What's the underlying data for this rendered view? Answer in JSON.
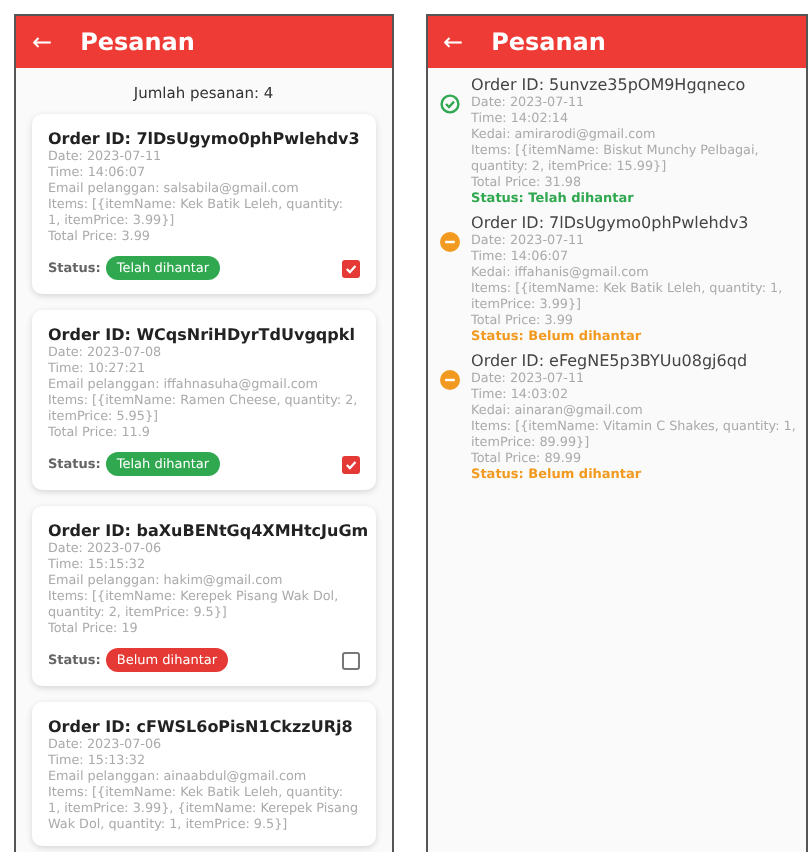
{
  "left_screen": {
    "title": "Pesanan",
    "back_icon": "←",
    "count_label": "Jumlah pesanan: 4",
    "orders": [
      {
        "order_id": "Order ID: 7lDsUgymo0phPwlehdv3",
        "date": "Date: 2023-07-11",
        "time": "Time: 14:06:07",
        "email": "Email pelanggan: salsabila@gmail.com",
        "items": "Items: [{itemName: Kek Batik Leleh, quantity: 1, itemPrice: 3.99}]",
        "total": "Total Price: 3.99",
        "status_label": "Status:",
        "status": "Telah dihantar",
        "delivered": true,
        "checked": true
      },
      {
        "order_id": "Order ID: WCqsNriHDyrTdUvgqpkl",
        "date": "Date: 2023-07-08",
        "time": "Time: 10:27:21",
        "email": "Email pelanggan: iffahnasuha@gmail.com",
        "items": "Items: [{itemName: Ramen Cheese, quantity: 2, itemPrice: 5.95}]",
        "total": "Total Price: 11.9",
        "status_label": "Status:",
        "status": "Telah dihantar",
        "delivered": true,
        "checked": true
      },
      {
        "order_id": "Order ID: baXuBENtGq4XMHtcJuGm",
        "date": "Date: 2023-07-06",
        "time": "Time: 15:15:32",
        "email": "Email pelanggan: hakim@gmail.com",
        "items": "Items: [{itemName: Kerepek Pisang Wak Dol, quantity: 2, itemPrice: 9.5}]",
        "total": "Total Price: 19",
        "status_label": "Status:",
        "status": "Belum dihantar",
        "delivered": false,
        "checked": false
      },
      {
        "order_id": "Order ID: cFWSL6oPisN1CkzzURj8",
        "date": "Date: 2023-07-06",
        "time": "Time: 15:13:32",
        "email": "Email pelanggan: ainaabdul@gmail.com",
        "items": "Items: [{itemName: Kek Batik Leleh, quantity: 1, itemPrice: 3.99}, {itemName: Kerepek Pisang Wak Dol, quantity: 1, itemPrice: 9.5}]"
      }
    ]
  },
  "right_screen": {
    "title": "Pesanan",
    "back_icon": "←",
    "orders": [
      {
        "order_id": "Order ID: 5unvze35pOM9Hgqneco",
        "date": "Date: 2023-07-11",
        "time": "Time: 14:02:14",
        "shop": "Kedai: amirarodi@gmail.com",
        "items": "Items: [{itemName: Biskut Munchy Pelbagai, quantity: 2, itemPrice: 15.99}]",
        "total": "Total Price: 31.98",
        "status": "Status: Telah dihantar",
        "delivered": true
      },
      {
        "order_id": "Order ID: 7lDsUgymo0phPwlehdv3",
        "date": "Date: 2023-07-11",
        "time": "Time: 14:06:07",
        "shop": "Kedai: iffahanis@gmail.com",
        "items": "Items: [{itemName: Kek Batik Leleh, quantity: 1, itemPrice: 3.99}]",
        "total": "Total Price: 3.99",
        "status": "Status: Belum dihantar",
        "delivered": false
      },
      {
        "order_id": "Order ID: eFegNE5p3BYUu08gj6qd",
        "date": "Date: 2023-07-11",
        "time": "Time: 14:03:02",
        "shop": "Kedai: ainaran@gmail.com",
        "items": "Items: [{itemName: Vitamin C Shakes, quantity: 1, itemPrice: 89.99}]",
        "total": "Total Price: 89.99",
        "status": "Status: Belum dihantar",
        "delivered": false
      }
    ]
  }
}
